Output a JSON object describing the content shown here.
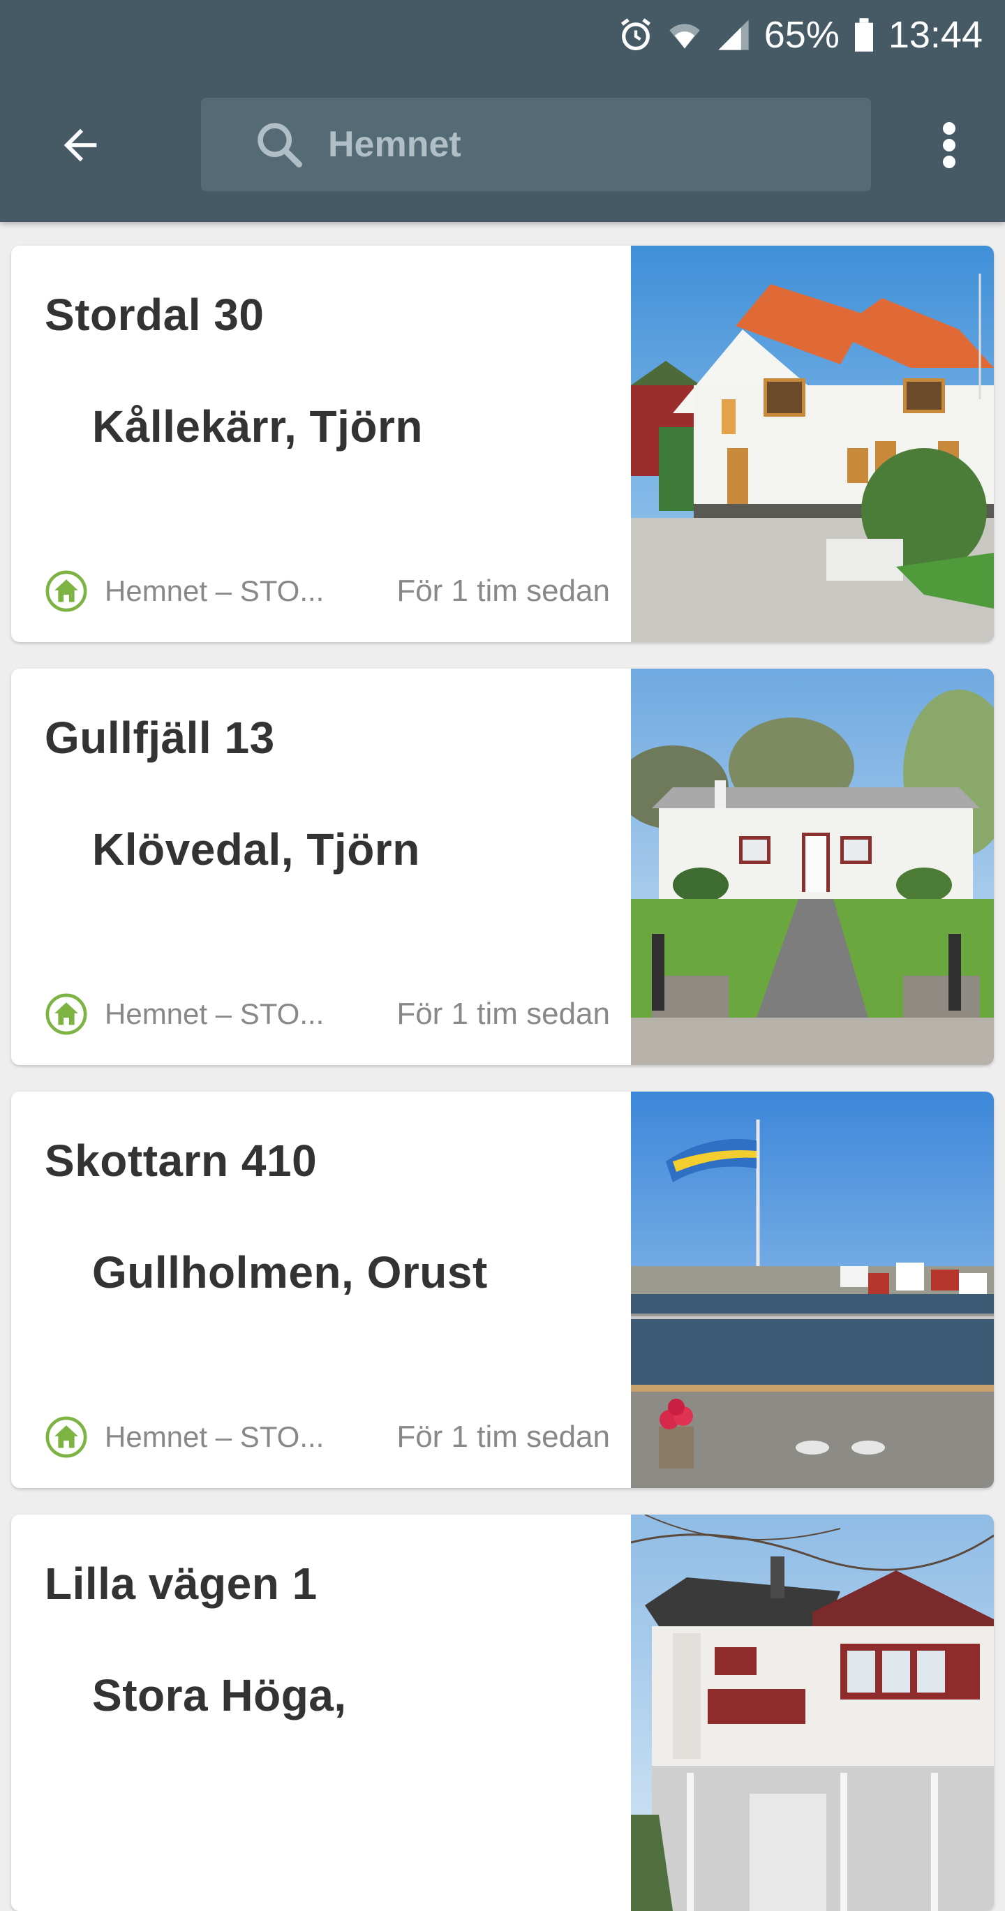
{
  "status_bar": {
    "battery": "65%",
    "time": "13:44",
    "icons": [
      "alarm-icon",
      "wifi-icon",
      "signal-icon",
      "battery-icon"
    ]
  },
  "header": {
    "back_icon": "arrow-left-icon",
    "search_value": "Hemnet",
    "search_icon": "search-icon",
    "menu_icon": "more-vert-icon",
    "background_color": "#455a64"
  },
  "listings": [
    {
      "title": "Stordal 30",
      "location": "Kållekärr, Tjörn",
      "source": "Hemnet – STO...",
      "time": "För 1 tim sedan",
      "image": "house-photo"
    },
    {
      "title": "Gullfjäll 13",
      "location": "Klövedal, Tjörn",
      "source": "Hemnet – STO...",
      "time": "För 1 tim sedan",
      "image": "house-photo"
    },
    {
      "title": "Skottarn 410",
      "location": "Gullholmen, Orust",
      "source": "Hemnet – STO...",
      "time": "För 1 tim sedan",
      "image": "harbor-photo"
    },
    {
      "title": "Lilla vägen 1",
      "location": "Stora Höga,",
      "source": "",
      "time": "",
      "image": "house-photo"
    }
  ],
  "colors": {
    "source_icon": "#7cb342",
    "text_primary": "#333333",
    "text_secondary": "#888888"
  }
}
